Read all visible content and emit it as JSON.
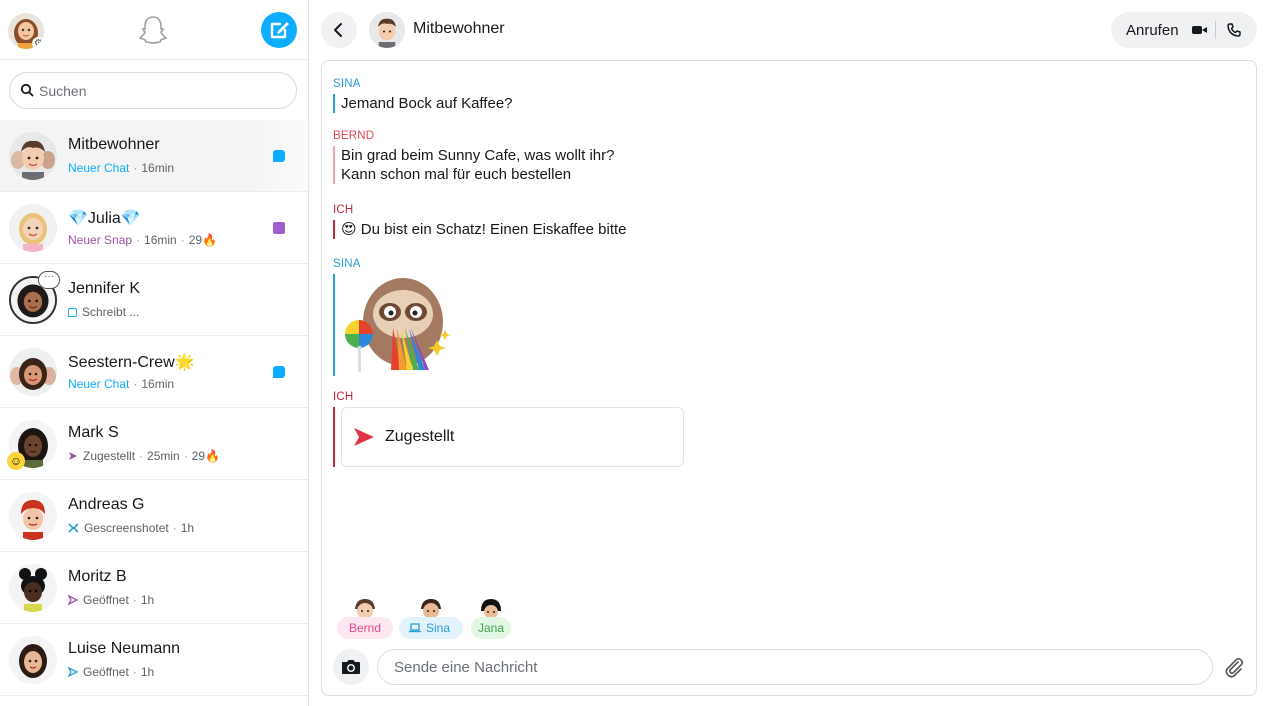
{
  "sidebar": {
    "search_placeholder": "Suchen",
    "chats": [
      {
        "name": "Mitbewohner",
        "status": "Neuer Chat",
        "status_kind": "new-chat",
        "time": "16min",
        "streak": "",
        "indicator": "chat"
      },
      {
        "name": "💎Julia💎",
        "status": "Neuer Snap",
        "status_kind": "new-snap",
        "time": "16min",
        "streak": "29🔥",
        "indicator": "snap"
      },
      {
        "name": "Jennifer K",
        "status": "Schreibt ...",
        "status_kind": "typing",
        "time": "",
        "streak": "",
        "indicator": "none"
      },
      {
        "name": "Seestern-Crew🌟",
        "status": "Neuer Chat",
        "status_kind": "new-chat",
        "time": "16min",
        "streak": "",
        "indicator": "chat"
      },
      {
        "name": "Mark S",
        "status": "Zugestellt",
        "status_kind": "delivered",
        "time": "25min",
        "streak": "29🔥",
        "indicator": "none"
      },
      {
        "name": "Andreas G",
        "status": "Gescreenshotet",
        "status_kind": "screenshot",
        "time": "1h",
        "streak": "",
        "indicator": "none"
      },
      {
        "name": "Moritz B",
        "status": "Geöffnet",
        "status_kind": "opened-snap",
        "time": "1h",
        "streak": "",
        "indicator": "none"
      },
      {
        "name": "Luise Neumann",
        "status": "Geöffnet",
        "status_kind": "opened-chat",
        "time": "1h",
        "streak": "",
        "indicator": "none"
      }
    ]
  },
  "header": {
    "title": "Mitbewohner",
    "call_label": "Anrufen"
  },
  "messages": [
    {
      "sender": "SINA",
      "lines": [
        "Jemand Bock auf Kaffee?"
      ]
    },
    {
      "sender": "BERND",
      "lines": [
        "Bin grad beim Sunny Cafe, was wollt ihr?",
        "Kann schon mal für euch bestellen"
      ]
    },
    {
      "sender": "ICH",
      "lines": [
        "😍 Du bist ein Schatz! Einen Eiskaffee bitte"
      ]
    },
    {
      "sender": "SINA",
      "sticker": "sloth-rainbow-sticker"
    },
    {
      "sender": "ICH",
      "snap_status": "Zugestellt"
    }
  ],
  "presence": [
    {
      "name": "Bernd",
      "color": "#e8488a",
      "bg": "#fde7f0"
    },
    {
      "name": "Sina",
      "color": "#2a9fd6",
      "bg": "#e3f3fc"
    },
    {
      "name": "Jana",
      "color": "#3fa34d",
      "bg": "#e2f6e4"
    }
  ],
  "composer": {
    "placeholder": "Sende eine Nachricht"
  },
  "colors": {
    "accent_blue": "#0eadff",
    "snap_purple": "#a05dcd",
    "sina": "#2a9fd6",
    "bernd": "#e0464f",
    "ich": "#c02a3a"
  }
}
